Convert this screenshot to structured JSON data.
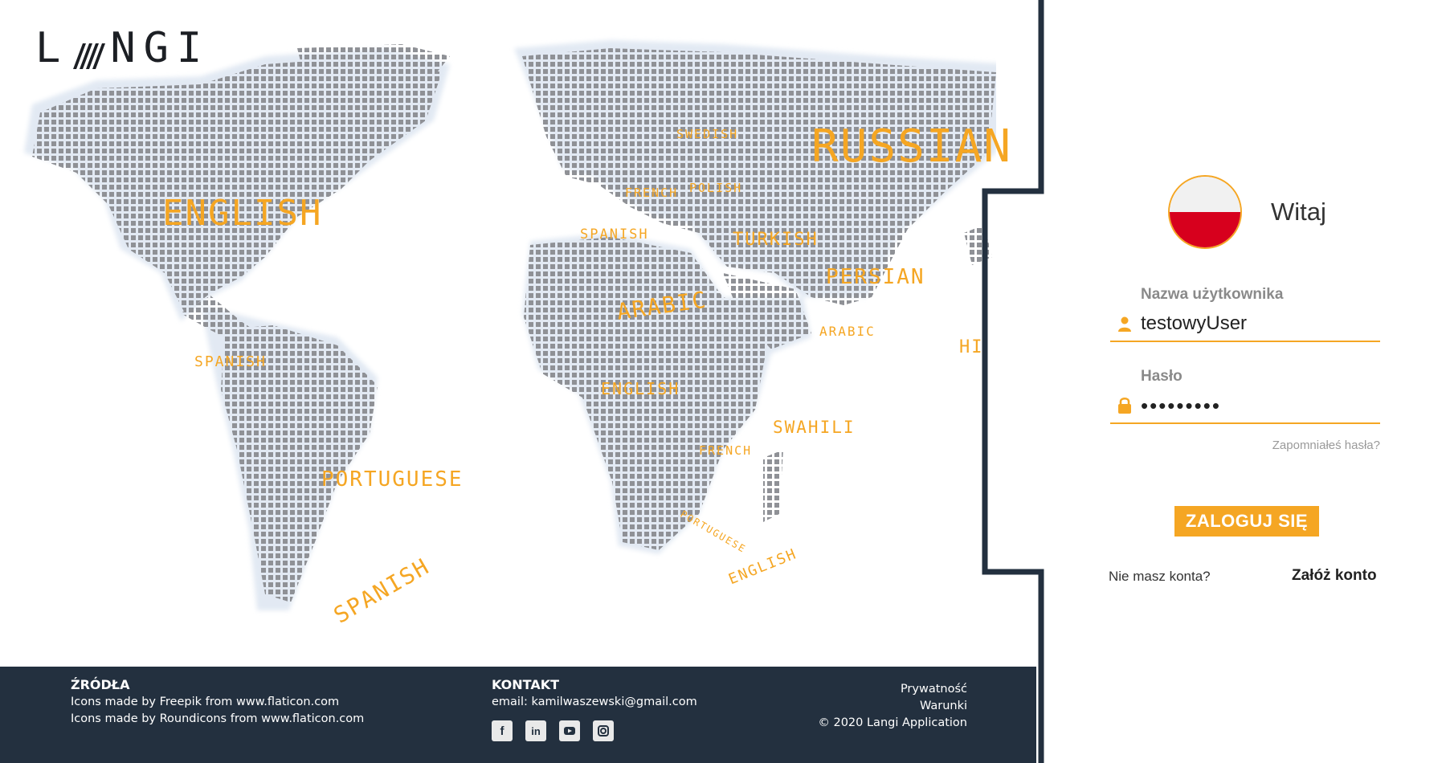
{
  "app": {
    "logo_text": "NGI",
    "logo_letter": "L"
  },
  "map": {
    "languages": [
      {
        "id": "russian",
        "text": "RUSSIAN"
      },
      {
        "id": "english-na",
        "text": "ENGLISH"
      },
      {
        "id": "swedish",
        "text": "SWEDISH"
      },
      {
        "id": "french-eu",
        "text": "FRENCH"
      },
      {
        "id": "polish",
        "text": "POLISH"
      },
      {
        "id": "spanish-eu",
        "text": "SPANISH"
      },
      {
        "id": "turkish",
        "text": "TURKISH"
      },
      {
        "id": "persian",
        "text": "PERSIAN"
      },
      {
        "id": "arabic-na",
        "text": "ARABIC"
      },
      {
        "id": "arabic-me",
        "text": "ARABIC"
      },
      {
        "id": "hi",
        "text": "HI"
      },
      {
        "id": "spanish-ca",
        "text": "SPANISH"
      },
      {
        "id": "english-wa",
        "text": "ENGLISH"
      },
      {
        "id": "swahili",
        "text": "SWAHILI"
      },
      {
        "id": "french-af",
        "text": "FRENCH"
      },
      {
        "id": "portuguese-sa",
        "text": "PORTUGUESE"
      },
      {
        "id": "portuguese-af",
        "text": "PORTUGUESE"
      },
      {
        "id": "english-af",
        "text": "ENGLISH"
      },
      {
        "id": "spanish-sa",
        "text": "SPANISH"
      }
    ]
  },
  "footer": {
    "sources": {
      "heading": "ŹRÓDŁA",
      "line1": "Icons made by Freepik from www.flaticon.com",
      "line2": "Icons made by Roundicons from www.flaticon.com"
    },
    "contact": {
      "heading": "KONTAKT",
      "email": "email: kamilwaszewski@gmail.com",
      "socials": [
        "facebook-icon",
        "linkedin-icon",
        "youtube-icon",
        "instagram-icon"
      ]
    },
    "legal": {
      "privacy": "Prywatność",
      "terms": "Warunki",
      "copyright": "© 2020 Langi Application"
    }
  },
  "login": {
    "greeting": "Witaj",
    "username_label": "Nazwa użytkownika",
    "username_value": "testowyUser",
    "password_label": "Hasło",
    "password_value": "password1",
    "forgot": "Zapomniałeś hasła?",
    "submit": "ZALOGUJ SIĘ",
    "no_account": "Nie masz konta?",
    "create_account": "Załóż konto"
  },
  "colors": {
    "accent": "#f5a623",
    "dark": "#23303f",
    "flag_red": "#d7001d"
  }
}
